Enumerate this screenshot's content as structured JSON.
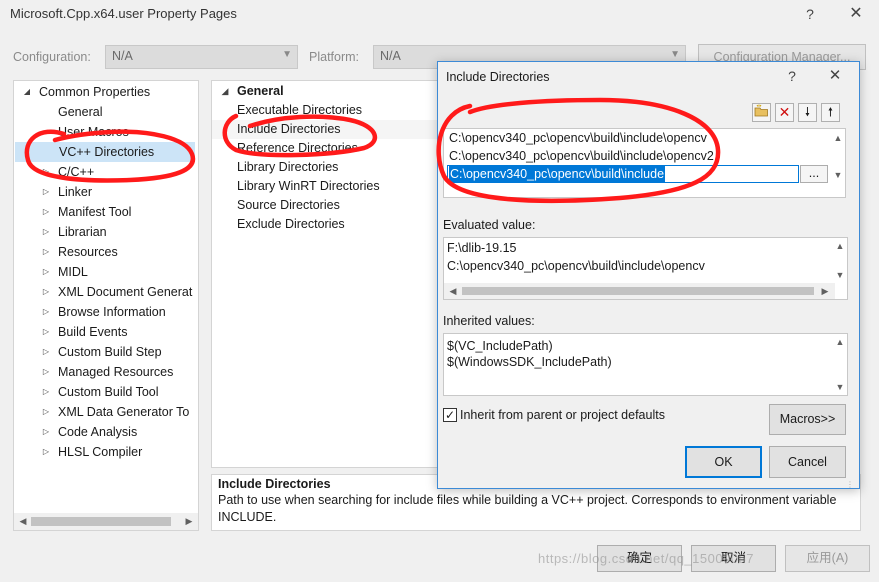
{
  "window": {
    "title": "Microsoft.Cpp.x64.user Property Pages",
    "help_glyph": "?",
    "close_glyph": "✕"
  },
  "toolbar": {
    "configuration_label": "Configuration:",
    "configuration_value": "N/A",
    "platform_label": "Platform:",
    "platform_value": "N/A",
    "config_manager_label": "Configuration Manager..."
  },
  "tree": {
    "items": [
      {
        "label": "Common Properties",
        "expanded": true,
        "level": 0
      },
      {
        "label": "General",
        "level": 1
      },
      {
        "label": "User Macros",
        "level": 1
      },
      {
        "label": "VC++ Directories",
        "level": 1,
        "selected": true
      },
      {
        "label": "C/C++",
        "level": 1,
        "collapsed": true
      },
      {
        "label": "Linker",
        "level": 1,
        "collapsed": true
      },
      {
        "label": "Manifest Tool",
        "level": 1,
        "collapsed": true
      },
      {
        "label": "Librarian",
        "level": 1,
        "collapsed": true
      },
      {
        "label": "Resources",
        "level": 1,
        "collapsed": true
      },
      {
        "label": "MIDL",
        "level": 1,
        "collapsed": true
      },
      {
        "label": "XML Document Generat",
        "level": 1,
        "collapsed": true
      },
      {
        "label": "Browse Information",
        "level": 1,
        "collapsed": true
      },
      {
        "label": "Build Events",
        "level": 1,
        "collapsed": true
      },
      {
        "label": "Custom Build Step",
        "level": 1,
        "collapsed": true
      },
      {
        "label": "Managed Resources",
        "level": 1,
        "collapsed": true
      },
      {
        "label": "Custom Build Tool",
        "level": 1,
        "collapsed": true
      },
      {
        "label": "XML Data Generator To",
        "level": 1,
        "collapsed": true
      },
      {
        "label": "Code Analysis",
        "level": 1,
        "collapsed": true
      },
      {
        "label": "HLSL Compiler",
        "level": 1,
        "collapsed": true
      }
    ]
  },
  "properties": {
    "section": "General",
    "rows": [
      "Executable Directories",
      "Include Directories",
      "Reference Directories",
      "Library Directories",
      "Library WinRT Directories",
      "Source Directories",
      "Exclude Directories"
    ]
  },
  "description": {
    "title": "Include Directories",
    "text": "Path to use when searching for include files while building a VC++ project.  Corresponds to environment variable INCLUDE."
  },
  "dialog": {
    "title": "Include Directories",
    "help_glyph": "?",
    "close_glyph": "✕",
    "toolbar_icons": [
      "new-folder-icon",
      "delete-icon",
      "move-down-icon",
      "move-up-icon"
    ],
    "entries": [
      "C:\\opencv340_pc\\opencv\\build\\include\\opencv",
      "C:\\opencv340_pc\\opencv\\build\\include\\opencv2",
      "C:\\opencv340_pc\\opencv\\build\\include"
    ],
    "browse_label": "...",
    "evaluated_label": "Evaluated value:",
    "evaluated_lines": [
      "F:\\dlib-19.15",
      "C:\\opencv340_pc\\opencv\\build\\include\\opencv"
    ],
    "inherited_label": "Inherited values:",
    "inherited_lines": [
      "$(VC_IncludePath)",
      "$(WindowsSDK_IncludePath)"
    ],
    "inherit_checkbox_label": "Inherit from parent or project defaults",
    "inherit_checked": true,
    "macros_label": "Macros>>",
    "ok_label": "OK",
    "cancel_label": "Cancel"
  },
  "footer": {
    "ok_label": "确定",
    "cancel_label": "取消",
    "apply_label": "应用(A)",
    "watermark": "https://blog.csdn.net/qq_15000057"
  },
  "colors": {
    "accent": "#0078d7",
    "annotation": "#ff1a1a",
    "selection": "#cce4f7"
  }
}
